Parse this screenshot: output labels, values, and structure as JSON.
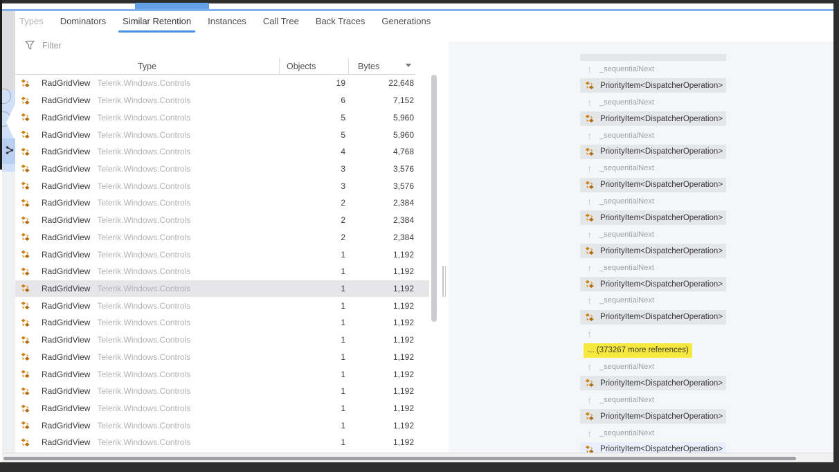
{
  "tabs": {
    "items": [
      {
        "label": "Types",
        "state": "disabled"
      },
      {
        "label": "Dominators",
        "state": "normal"
      },
      {
        "label": "Similar Retention",
        "state": "active"
      },
      {
        "label": "Instances",
        "state": "normal"
      },
      {
        "label": "Call Tree",
        "state": "normal"
      },
      {
        "label": "Back Traces",
        "state": "normal"
      },
      {
        "label": "Generations",
        "state": "normal"
      }
    ]
  },
  "filter": {
    "label": "Filter"
  },
  "table": {
    "columns": {
      "type": "Type",
      "objects": "Objects",
      "bytes": "Bytes"
    },
    "type_name": "RadGridView",
    "namespace": "Telerik.Windows.Controls",
    "selected_index": 12,
    "rows": [
      {
        "objects": "19",
        "bytes": "22,648"
      },
      {
        "objects": "6",
        "bytes": "7,152"
      },
      {
        "objects": "5",
        "bytes": "5,960"
      },
      {
        "objects": "5",
        "bytes": "5,960"
      },
      {
        "objects": "4",
        "bytes": "4,768"
      },
      {
        "objects": "3",
        "bytes": "3,576"
      },
      {
        "objects": "3",
        "bytes": "3,576"
      },
      {
        "objects": "2",
        "bytes": "2,384"
      },
      {
        "objects": "2",
        "bytes": "2,384"
      },
      {
        "objects": "2",
        "bytes": "2,384"
      },
      {
        "objects": "1",
        "bytes": "1,192"
      },
      {
        "objects": "1",
        "bytes": "1,192"
      },
      {
        "objects": "1",
        "bytes": "1,192"
      },
      {
        "objects": "1",
        "bytes": "1,192"
      },
      {
        "objects": "1",
        "bytes": "1,192"
      },
      {
        "objects": "1",
        "bytes": "1,192"
      },
      {
        "objects": "1",
        "bytes": "1,192"
      },
      {
        "objects": "1",
        "bytes": "1,192"
      },
      {
        "objects": "1",
        "bytes": "1,192"
      },
      {
        "objects": "1",
        "bytes": "1,192"
      },
      {
        "objects": "1",
        "bytes": "1,192"
      },
      {
        "objects": "1",
        "bytes": "1,192"
      }
    ]
  },
  "retention": {
    "node_label": "PriorityItem<DispatcherOperation>",
    "link_label": "_sequentialNext",
    "more_label": "... (373267 more references)",
    "chain": [
      "partial",
      "link",
      "node",
      "link",
      "node",
      "link",
      "node",
      "link",
      "node",
      "link",
      "node",
      "link",
      "node",
      "link",
      "node",
      "link",
      "node",
      "arrow",
      "more",
      "link",
      "node",
      "link",
      "node",
      "link",
      "node-selected"
    ]
  },
  "colors": {
    "accent_blue": "#64a0e6",
    "tab_underline": "#4a8fe2",
    "highlight_yellow": "#f6e83e",
    "node_gray": "#e5e6e8",
    "selected_node_blue": "#e9effc",
    "selected_row_gray": "#e6e6e8",
    "icon_orange": "#d4881c",
    "panel_bg": "#f5f6f8"
  }
}
